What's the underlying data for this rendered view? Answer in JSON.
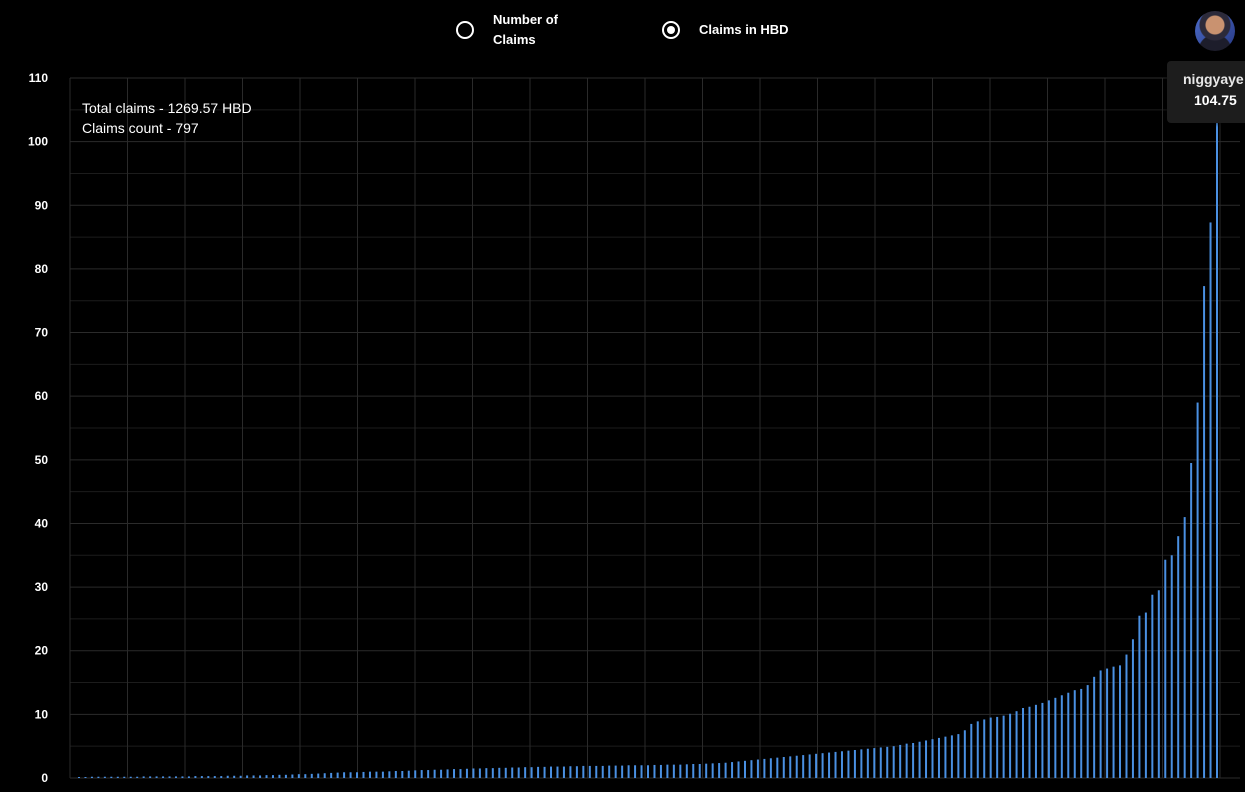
{
  "toggle": {
    "options": [
      {
        "label": "Number of Claims",
        "selected": false
      },
      {
        "label": "Claims in HBD",
        "selected": true
      }
    ]
  },
  "user": {
    "avatar_icon": "user-avatar-icon"
  },
  "summary": {
    "total_claims": "Total claims - 1269.57 HBD",
    "claims_count": "Claims count - 797"
  },
  "tooltip": {
    "name": "niggyaye",
    "value": "104.75"
  },
  "colors": {
    "bar": "#4a90e2",
    "grid": "#2a2a2a",
    "background": "#000000"
  },
  "chart_data": {
    "type": "bar",
    "title": "",
    "xlabel": "",
    "ylabel": "",
    "ylim": [
      0,
      110
    ],
    "grid": true,
    "y_ticks": [
      0,
      10,
      20,
      30,
      40,
      50,
      60,
      70,
      80,
      90,
      100,
      110
    ],
    "values": [
      0.15,
      0.15,
      0.2,
      0.2,
      0.2,
      0.2,
      0.2,
      0.2,
      0.2,
      0.2,
      0.25,
      0.25,
      0.25,
      0.25,
      0.25,
      0.25,
      0.25,
      0.25,
      0.3,
      0.3,
      0.3,
      0.3,
      0.3,
      0.35,
      0.35,
      0.35,
      0.4,
      0.4,
      0.4,
      0.45,
      0.45,
      0.5,
      0.5,
      0.55,
      0.6,
      0.6,
      0.65,
      0.7,
      0.75,
      0.8,
      0.85,
      0.9,
      0.9,
      0.9,
      0.95,
      1.0,
      1.0,
      1.0,
      1.05,
      1.1,
      1.1,
      1.15,
      1.2,
      1.25,
      1.25,
      1.3,
      1.3,
      1.35,
      1.4,
      1.4,
      1.45,
      1.5,
      1.5,
      1.55,
      1.55,
      1.6,
      1.6,
      1.65,
      1.65,
      1.7,
      1.7,
      1.75,
      1.75,
      1.8,
      1.8,
      1.8,
      1.85,
      1.85,
      1.9,
      1.9,
      1.9,
      1.9,
      1.95,
      1.95,
      1.95,
      2.0,
      2.0,
      2.0,
      2.0,
      2.05,
      2.05,
      2.1,
      2.1,
      2.1,
      2.15,
      2.2,
      2.2,
      2.25,
      2.3,
      2.35,
      2.4,
      2.5,
      2.6,
      2.7,
      2.8,
      2.9,
      3.0,
      3.1,
      3.2,
      3.3,
      3.4,
      3.5,
      3.6,
      3.7,
      3.8,
      3.9,
      4.0,
      4.1,
      4.2,
      4.3,
      4.4,
      4.5,
      4.6,
      4.7,
      4.8,
      4.9,
      5.0,
      5.2,
      5.4,
      5.5,
      5.7,
      5.9,
      6.1,
      6.3,
      6.5,
      6.7,
      6.9,
      7.5,
      8.5,
      8.9,
      9.2,
      9.5,
      9.6,
      9.8,
      10.1,
      10.5,
      11.0,
      11.2,
      11.5,
      11.8,
      12.2,
      12.6,
      13.0,
      13.4,
      13.8,
      14.0,
      14.6,
      15.9,
      16.9,
      17.2,
      17.5,
      17.7,
      19.4,
      21.8,
      25.5,
      26.0,
      28.8,
      29.5,
      34.3,
      35.0,
      38.0,
      41.0,
      49.5,
      59.0,
      77.3,
      87.3,
      104.75
    ]
  }
}
